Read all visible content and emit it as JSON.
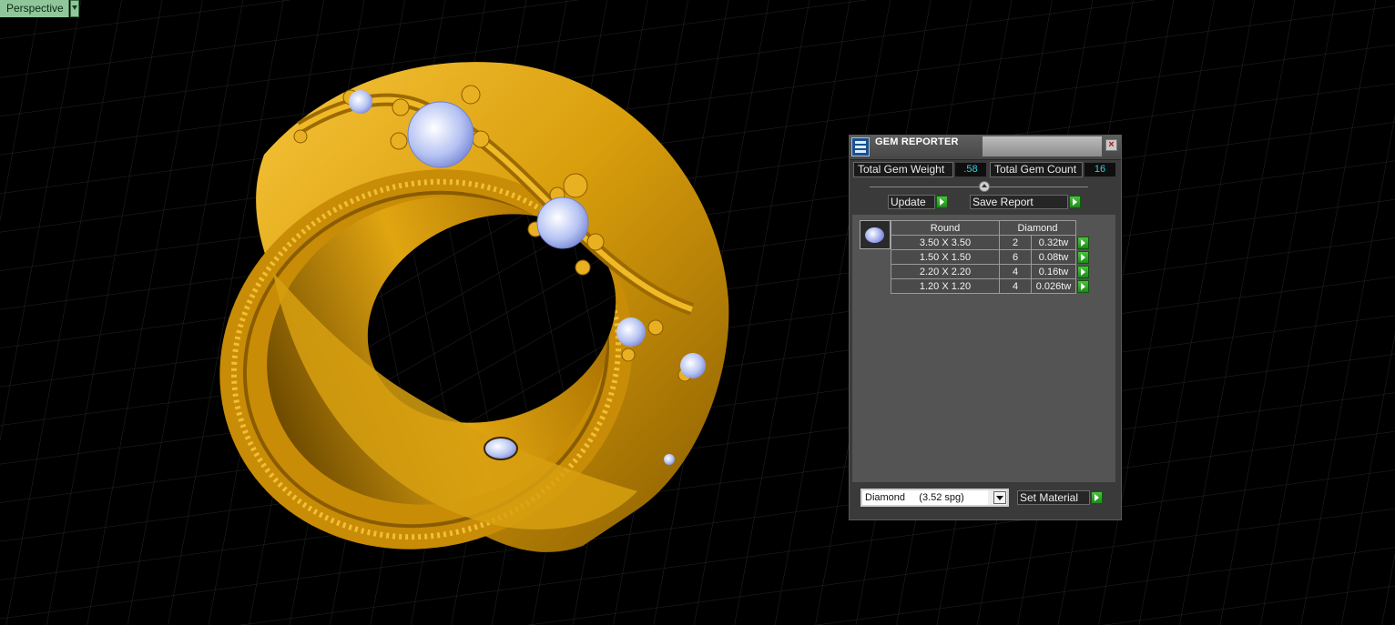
{
  "viewport": {
    "label": "Perspective"
  },
  "panel": {
    "title": "GEM REPORTER",
    "close_glyph": "×",
    "total_weight_label": "Total Gem Weight",
    "total_weight_value": ".58",
    "total_count_label": "Total Gem Count",
    "total_count_value": "16",
    "update_label": "Update",
    "save_report_label": "Save Report",
    "gem_table": {
      "icon": "gem-icon",
      "header_shape": "Round",
      "header_material": "Diamond",
      "rows": [
        {
          "size": "3.50 X 3.50",
          "count": "2",
          "weight": "0.32tw"
        },
        {
          "size": "1.50 X 1.50",
          "count": "6",
          "weight": "0.08tw"
        },
        {
          "size": "2.20 X 2.20",
          "count": "4",
          "weight": "0.16tw"
        },
        {
          "size": "1.20 X 1.20",
          "count": "4",
          "weight": "0.026tw"
        }
      ]
    },
    "material_select_value": "Diamond     (3.52 spg)",
    "set_material_label": "Set Material"
  },
  "colors": {
    "gold": "#d9a30a",
    "gem": "#b8c6f4",
    "accent_value": "#2fd1e6",
    "go_green": "#36a82b"
  }
}
